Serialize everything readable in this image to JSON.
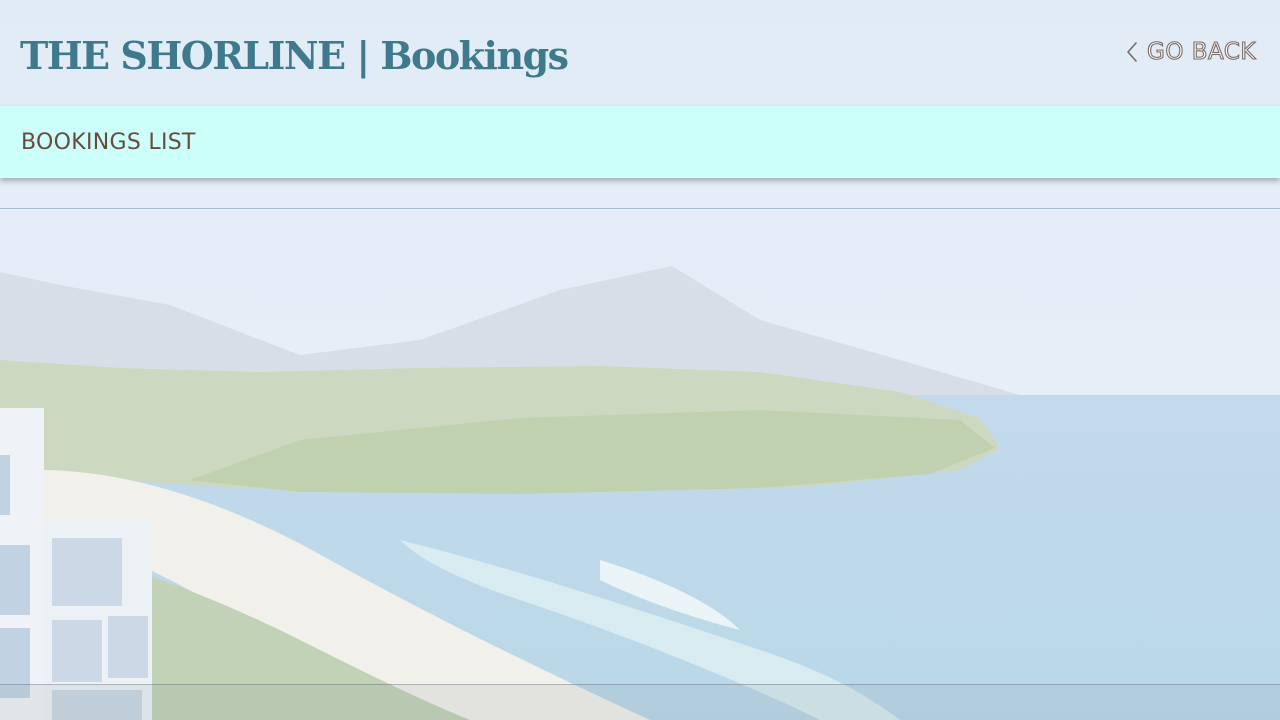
{
  "header": {
    "title": "THE SHORLINE | Bookings",
    "go_back_label": "GO BACK",
    "go_back_icon": "chevron-left-icon"
  },
  "section": {
    "title": "BOOKINGS LIST"
  },
  "bookings": [],
  "colors": {
    "brand_title": "#3f7a8c",
    "section_bar": "#ccfffa",
    "section_title": "#6b4a3e",
    "go_back_outline": "#7a6a66"
  }
}
